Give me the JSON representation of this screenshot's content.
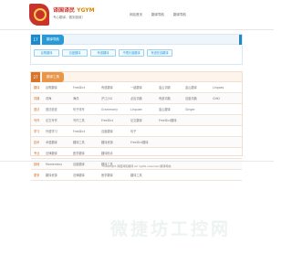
{
  "header": {
    "logo_title_cn": "译国译民",
    "logo_title_en": "YGYM",
    "logo_slogan": "专心翻译，做到极致！",
    "nav": [
      "网站首页",
      "翻译导航",
      "翻译导航"
    ]
  },
  "panel_nav": {
    "number": "17",
    "title": "翻译导航",
    "buttons": [
      "谷歌翻译",
      "百度翻译",
      "有道翻译",
      "不限长度翻译",
      "有道在线翻译"
    ]
  },
  "panel_tools": {
    "number": "27",
    "title": "翻译工具",
    "rows": [
      {
        "cat": "翻译",
        "cells": [
          "谷歌翻译",
          "FreeDict",
          "有道翻译",
          "一键翻译",
          "金山词霸",
          "金山翻译",
          "Lingoes"
        ]
      },
      {
        "cat": "词典",
        "cells": [
          "词海",
          "海词",
          "沪江小D",
          "必应词典",
          "有道词典",
          "百度词典",
          "CNKI"
        ]
      },
      {
        "cat": "语法",
        "cells": [
          "语法检查",
          "句子改写",
          "Grammarly",
          "Linguee",
          "金山翻译",
          "Ginger"
        ]
      },
      {
        "cat": "写作",
        "cells": [
          "论文写作",
          "写作工具",
          "FreeDict",
          "论文翻译",
          "FreeDict翻译"
        ]
      },
      {
        "cat": "学习",
        "cells": [
          "外语学习",
          "FreeDict",
          "百度翻译",
          "句子"
        ]
      },
      {
        "cat": "技术",
        "cells": [
          "术语翻译",
          "翻译工具",
          "翻译资源",
          "FreeDict翻译"
        ]
      },
      {
        "cat": "专业",
        "cells": [
          "法律翻译",
          "医学翻译",
          "翻译助手"
        ]
      },
      {
        "cat": "其他",
        "cells": [
          "Momentary",
          "百度翻译",
          "翻译工具"
        ]
      },
      {
        "cat": "更多",
        "cells": [
          "翻译资源",
          "法律翻译",
          "医学翻译",
          "翻译工具"
        ]
      }
    ]
  },
  "footer": {
    "copyright": "Copyright 译国译民翻译 All rights reserved 翻译导航"
  },
  "watermark": {
    "text": "微捷坊工控网"
  }
}
